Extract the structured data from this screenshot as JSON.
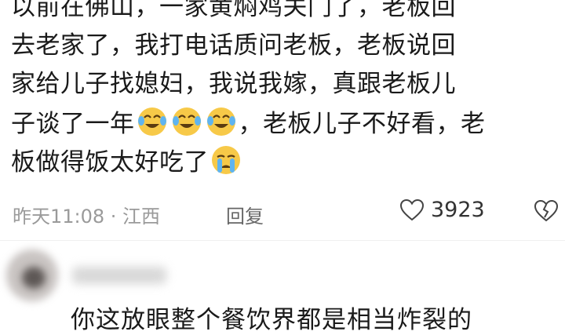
{
  "comment": {
    "lines": [
      "以前在佛山，一家黄焖鸡关门了，老板回",
      "去老家了，我打电话质问老板，老板说回",
      "家给儿子找媳妇，我说我嫁，真跟老板儿"
    ],
    "line4_prefix": "子谈了一年",
    "line4_suffix": "，老板儿子不好看，老",
    "line5_text": "板做得饭太好吃了",
    "emojis": [
      "laugh-cry-emoji",
      "laugh-cry-emoji",
      "laugh-cry-emoji",
      "crying-emoji"
    ]
  },
  "meta": {
    "time_location": "昨天11:08 · 江西",
    "reply_label": "回复",
    "like_count": "3923"
  },
  "next_comment": {
    "text_partial": "你这放眼整个餐饮界都是相当炸裂的"
  },
  "colors": {
    "meta_gray": "#9a9a9a",
    "text": "#1a1a1a",
    "emoji_yellow": "#f7c948",
    "tear_blue": "#5fb4f0"
  }
}
